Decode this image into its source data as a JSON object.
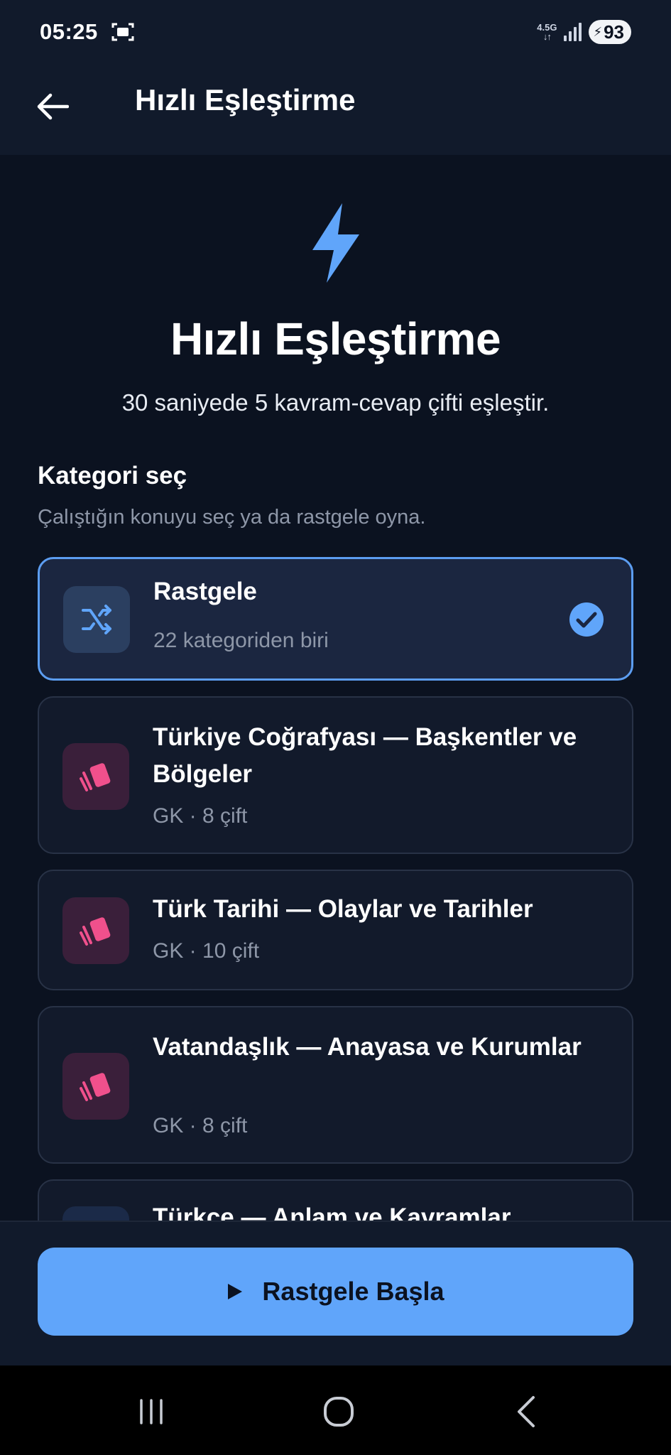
{
  "status_bar": {
    "time": "05:25",
    "network": "4.5G",
    "battery": "93"
  },
  "app_bar": {
    "title": "Hızlı Eşleştirme",
    "back_icon": "arrow-left-icon"
  },
  "hero": {
    "icon": "lightning-bolt-icon",
    "title": "Hızlı Eşleştirme",
    "subtitle": "30 saniyede 5 kavram-cevap çifti eşleştir."
  },
  "category_section": {
    "title": "Kategori seç",
    "subtitle": "Çalıştığın konuyu seç ya da rastgele oyna."
  },
  "categories": [
    {
      "title": "Rastgele",
      "subtitle": "22 kategoriden biri",
      "icon": "shuffle-icon",
      "selected": true
    },
    {
      "title": "Türkiye Coğrafyası — Başkentler ve Bölgeler",
      "subtitle": "GK · 8 çift",
      "icon": "cards-icon",
      "selected": false
    },
    {
      "title": "Türk Tarihi — Olaylar ve Tarihler",
      "subtitle": "GK · 10 çift",
      "icon": "cards-icon",
      "selected": false
    },
    {
      "title": "Vatandaşlık — Anayasa ve Kurumlar",
      "subtitle": "GK · 8 çift",
      "icon": "cards-icon",
      "selected": false
    },
    {
      "title": "Türkçe — Anlam ve Kavramlar",
      "subtitle": "",
      "icon": "cards-icon",
      "selected": false
    }
  ],
  "start_button": {
    "label": "Rastgele Başla",
    "icon": "play-icon"
  },
  "colors": {
    "accent": "#60a5fa",
    "background": "#0b1220",
    "card_icon_pink": "#f0508c"
  }
}
